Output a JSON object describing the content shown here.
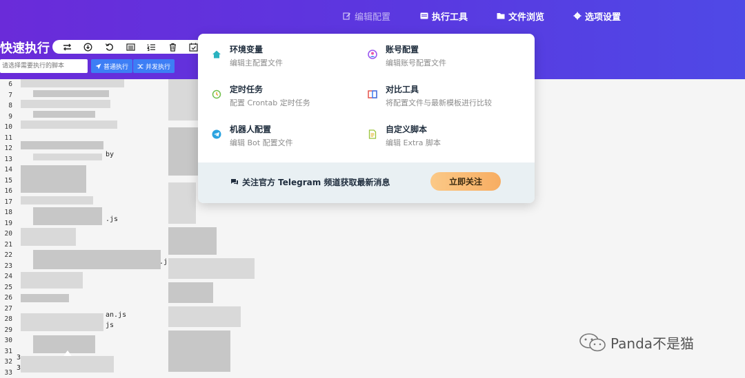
{
  "nav": {
    "edit_config": "编辑配置",
    "exec_tools": "执行工具",
    "file_browse": "文件浏览",
    "options": "选项设置"
  },
  "page": {
    "title": "快速执行"
  },
  "toolbar": {
    "tools": [
      "swap-icon",
      "download-icon",
      "undo-icon",
      "list-icon",
      "ordered-list-icon",
      "trash-icon",
      "calendar-check-icon"
    ]
  },
  "script": {
    "placeholder": "请选择需要执行的脚本",
    "normal_exec": "普通执行",
    "concurrent_exec": "并发执行"
  },
  "editor": {
    "line_numbers": [
      "6",
      "7",
      "8",
      "9",
      "10",
      "11",
      "12",
      "13",
      "14",
      "15",
      "16",
      "17",
      "18",
      "19",
      "20",
      "21",
      "22",
      "23",
      "24",
      "25",
      "26",
      "27",
      "28",
      "29",
      "30",
      "31",
      "32",
      "33"
    ],
    "fragments": [
      "by",
      ".js",
      ".j",
      "an.js",
      "js",
      "3",
      "3"
    ]
  },
  "menu": {
    "env": {
      "title": "环境变量",
      "subtitle": "编辑主配置文件",
      "icon": "home-icon",
      "color": "#2bb3c0"
    },
    "account": {
      "title": "账号配置",
      "subtitle": "编辑账号配置文件",
      "icon": "user-circle-icon",
      "color": "#9b59f0"
    },
    "cron": {
      "title": "定时任务",
      "subtitle": "配置 Crontab 定时任务",
      "icon": "clock-icon",
      "color": "#6fbf4a"
    },
    "compare": {
      "title": "对比工具",
      "subtitle": "将配置文件与最新模板进行比较",
      "icon": "columns-icon",
      "color": "#e5534b"
    },
    "bot": {
      "title": "机器人配置",
      "subtitle": "编辑 Bot 配置文件",
      "icon": "telegram-icon",
      "color": "#2aa3e0"
    },
    "extra": {
      "title": "自定义脚本",
      "subtitle": "编辑 Extra 脚本",
      "icon": "file-text-icon",
      "color": "#9ac43a"
    },
    "footer_text": "关注官方 Telegram 频道获取最新消息",
    "follow_button": "立即关注"
  },
  "watermark": {
    "text": "Panda不是猫"
  }
}
